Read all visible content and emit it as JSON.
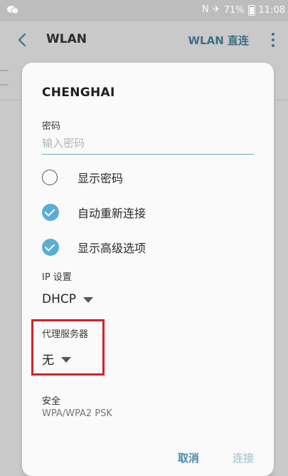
{
  "status_bar": {
    "left_icon": "chat-icon",
    "nfc_icon": "N",
    "airplane_icon": "✈",
    "battery_percent": "71%",
    "time": "11:08"
  },
  "app_bar": {
    "back_icon": "back-arrow-icon",
    "title": "WLAN",
    "wlan_direct": "WLAN 直连",
    "more_icon": "more-vertical-icon"
  },
  "dialog": {
    "network_name": "CHENGHAI",
    "password_label": "密码",
    "password_placeholder": "输入密码",
    "show_password": {
      "label": "显示密码",
      "checked": false
    },
    "auto_reconnect": {
      "label": "自动重新连接",
      "checked": true
    },
    "show_advanced": {
      "label": "显示高级选项",
      "checked": true
    },
    "ip_settings_label": "IP 设置",
    "ip_settings_value": "DHCP",
    "proxy_label": "代理服务器",
    "proxy_value": "无",
    "security_label": "安全",
    "security_value": "WPA/WPA2 PSK",
    "cancel_label": "取消",
    "connect_label": "连接"
  },
  "colors": {
    "accent": "#5aaed4",
    "highlight_box": "#d0222c",
    "connect_disabled": "#b5cfdc"
  }
}
